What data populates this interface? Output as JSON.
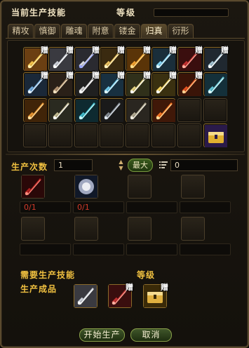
{
  "header": {
    "title": "当前生产技能",
    "level_label": "等级"
  },
  "tabs": [
    "精攻",
    "慎御",
    "雕魂",
    "附意",
    "镂金",
    "归真",
    "衍形"
  ],
  "active_tab": "归真",
  "grid": {
    "badge_text": "赠",
    "rows": [
      [
        {
          "icon": "golden-sword-icon",
          "badge": true
        },
        {
          "icon": "silver-blade-icon",
          "badge": true
        },
        {
          "icon": "ornate-sword-icon",
          "badge": true
        },
        {
          "icon": "gold-blade-icon",
          "badge": true
        },
        {
          "icon": "golden-axe-icon",
          "badge": true
        },
        {
          "icon": "ice-sword-icon",
          "badge": true
        },
        {
          "icon": "crimson-sword-icon",
          "badge": true
        },
        {
          "icon": "spear-icon",
          "badge": true
        }
      ],
      [
        {
          "icon": "twin-blade-icon",
          "badge": true
        },
        {
          "icon": "war-axe-icon",
          "badge": true
        },
        {
          "icon": "spiked-mace-icon",
          "badge": true
        },
        {
          "icon": "ice-axe-icon",
          "badge": true
        },
        {
          "icon": "glaive-icon",
          "badge": true
        },
        {
          "icon": "holy-sword-icon",
          "badge": true
        },
        {
          "icon": "red-claw-icon",
          "badge": true
        },
        {
          "icon": "serpent-sword-icon",
          "badge": false
        }
      ],
      [
        {
          "icon": "gold-gauntlet-icon",
          "badge": false
        },
        {
          "icon": "halberd-icon",
          "badge": false
        },
        {
          "icon": "cyan-blade-icon",
          "badge": false
        },
        {
          "icon": "dark-spear-icon",
          "badge": false
        },
        {
          "icon": "pickaxe-icon",
          "badge": false
        },
        {
          "icon": "flame-dagger-icon",
          "badge": false
        },
        {
          "icon": "",
          "badge": false
        },
        {
          "icon": "",
          "badge": false
        }
      ],
      [
        {
          "icon": "",
          "badge": false
        },
        {
          "icon": "",
          "badge": false
        },
        {
          "icon": "",
          "badge": false
        },
        {
          "icon": "",
          "badge": false
        },
        {
          "icon": "",
          "badge": false
        },
        {
          "icon": "",
          "badge": false
        },
        {
          "icon": "",
          "badge": false
        },
        {
          "icon": "treasure-chest-icon",
          "badge": false
        }
      ]
    ]
  },
  "quantity": {
    "label": "生产次数",
    "value": "1",
    "max_label": "最大",
    "owned_value": "0"
  },
  "materials": [
    {
      "icon": "red-rune-icon",
      "count": "0/1"
    },
    {
      "icon": "moon-orb-icon",
      "count": "0/1"
    },
    {
      "icon": "",
      "count": ""
    },
    {
      "icon": "",
      "count": ""
    },
    {
      "icon": "",
      "count": ""
    },
    {
      "icon": "",
      "count": ""
    },
    {
      "icon": "",
      "count": ""
    },
    {
      "icon": "",
      "count": ""
    }
  ],
  "requirements": {
    "skill_label": "需要生产技能",
    "level_label": "等级",
    "product_label": "生产成品"
  },
  "products": [
    {
      "icon": "silver-blade-icon",
      "badge": false
    },
    {
      "icon": "crimson-sword-icon",
      "badge": true
    },
    {
      "icon": "golden-scroll-icon",
      "badge": true
    }
  ],
  "buttons": {
    "start": "开始生产",
    "cancel": "取消"
  },
  "colors": {
    "accent_label": "#f0c040",
    "material_count": "#d23a2a",
    "button_border": "#8aa04a"
  }
}
